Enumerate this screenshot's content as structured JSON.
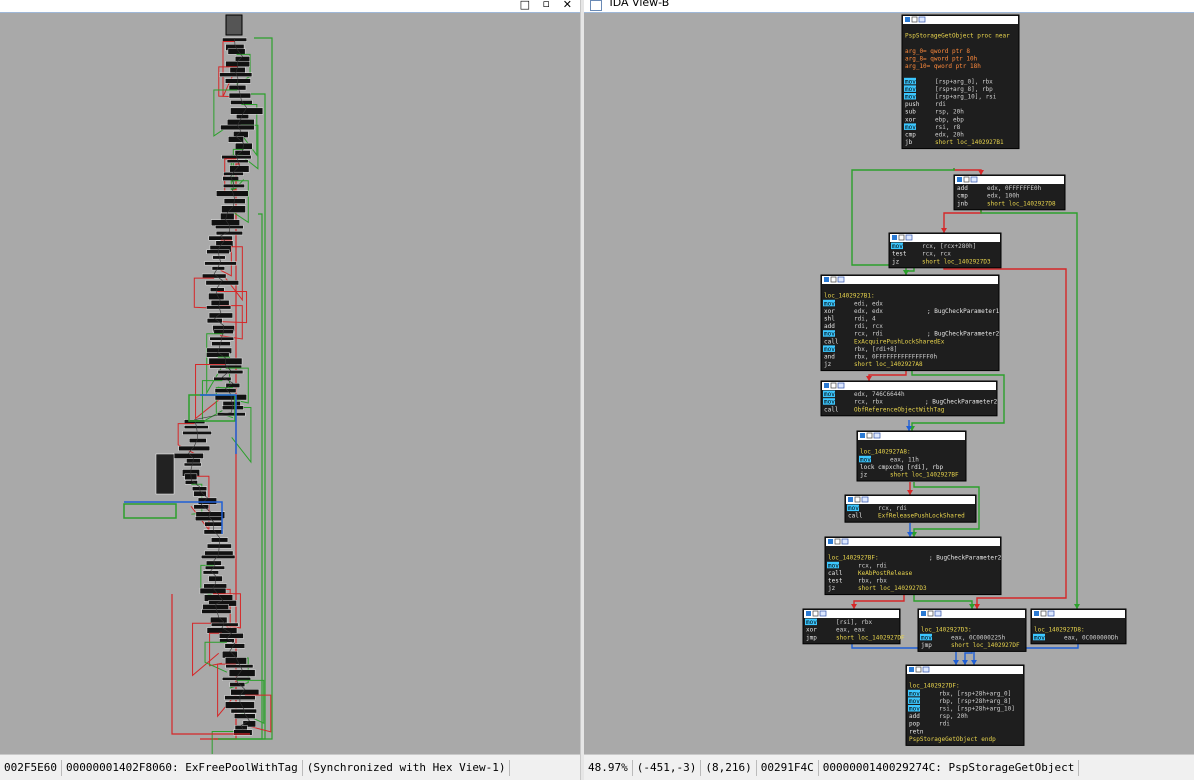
{
  "left_pane": {
    "status": {
      "address": "002F5E60",
      "location": "00000001402F8060: ExFreePoolWithTag",
      "sync": "(Synchronized with Hex View-1)"
    }
  },
  "right_pane": {
    "tab_title": "IDA View-B",
    "status": {
      "zoom": "48.97%",
      "coords": "(-451,-3)",
      "mouse": "(8,216)",
      "offset": "00291F4C",
      "location": "0000000140029274C: PspStorageGetObject"
    }
  },
  "colors": {
    "graph_bg": "#a9a9a9",
    "block_bg": "#1e1e1e",
    "edge_true": "#2ca02c",
    "edge_false": "#d62728",
    "edge_uncond": "#1f5fd6",
    "mnemonic_highlight": "#3cc7ff",
    "label_yellow": "#e8d44d",
    "operand_orange": "#ff8a3c"
  },
  "blocks": [
    {
      "id": "b1",
      "lines": [
        {
          "t": ""
        },
        {
          "t": "PspStorageGetObject proc near",
          "c": "label"
        },
        {
          "t": ""
        },
        {
          "t": "arg_0= qword ptr  8",
          "c": "orange"
        },
        {
          "t": "arg_8= qword ptr  10h",
          "c": "orange"
        },
        {
          "t": "arg_10= qword ptr  18h",
          "c": "orange"
        },
        {
          "t": ""
        },
        {
          "m": "mov",
          "o": "[rsp+arg_0], rbx"
        },
        {
          "m": "mov",
          "o": "[rsp+arg_8], rbp"
        },
        {
          "m": "mov",
          "o": "[rsp+arg_10], rsi"
        },
        {
          "m": "push",
          "o": "rdi"
        },
        {
          "m": "sub",
          "o": "rsp, 20h"
        },
        {
          "m": "xor",
          "o": "ebp, ebp"
        },
        {
          "m": "mov",
          "o": "rsi, r8"
        },
        {
          "m": "cmp",
          "o": "edx, 20h"
        },
        {
          "m": "jb",
          "o": "short loc_1402927B1"
        }
      ]
    },
    {
      "id": "b2",
      "lines": [
        {
          "m": "add",
          "o": "edx, 0FFFFFFE0h"
        },
        {
          "m": "cmp",
          "o": "edx, 100h"
        },
        {
          "m": "jnb",
          "o": "short loc_1402927D8"
        }
      ]
    },
    {
      "id": "b3",
      "lines": [
        {
          "m": "mov",
          "o": "rcx, [rcx+280h]"
        },
        {
          "m": "test",
          "o": "rcx, rcx"
        },
        {
          "m": "jz",
          "o": "short loc_1402927D3"
        }
      ]
    },
    {
      "id": "b4",
      "lines": [
        {
          "t": ""
        },
        {
          "t": "loc_1402927B1:",
          "c": "label"
        },
        {
          "m": "mov",
          "o": "edi, edx"
        },
        {
          "m": "xor",
          "o": "edx, edx",
          "cm": "; BugCheckParameter1"
        },
        {
          "m": "shl",
          "o": "rdi, 4"
        },
        {
          "m": "add",
          "o": "rdi, rcx"
        },
        {
          "m": "mov",
          "o": "rcx, rdi",
          "cm": "; BugCheckParameter2"
        },
        {
          "m": "call",
          "o": "ExAcquirePushLockSharedEx"
        },
        {
          "m": "mov",
          "o": "rbx, [rdi+8]"
        },
        {
          "m": "and",
          "o": "rbx, 0FFFFFFFFFFFFFFF0h"
        },
        {
          "m": "jz",
          "o": "short loc_1402927A8"
        }
      ]
    },
    {
      "id": "b5",
      "lines": [
        {
          "m": "mov",
          "o": "edx, 746C6644h"
        },
        {
          "m": "mov",
          "o": "rcx, rbx",
          "cm": "; BugCheckParameter2"
        },
        {
          "m": "call",
          "o": "ObfReferenceObjectWithTag"
        }
      ]
    },
    {
      "id": "b6",
      "lines": [
        {
          "t": ""
        },
        {
          "t": "loc_1402927A8:",
          "c": "label"
        },
        {
          "m": "mov",
          "o": "eax, 11h"
        },
        {
          "t": "lock cmpxchg [rdi], rbp",
          "c": "white"
        },
        {
          "m": "jz",
          "o": "short loc_1402927BF"
        }
      ]
    },
    {
      "id": "b7",
      "lines": [
        {
          "m": "mov",
          "o": "rcx, rdi"
        },
        {
          "m": "call",
          "o": "ExfReleasePushLockShared"
        }
      ]
    },
    {
      "id": "b8",
      "lines": [
        {
          "t": ""
        },
        {
          "t": "loc_1402927BF:",
          "c": "label",
          "cm": "; BugCheckParameter2"
        },
        {
          "m": "mov",
          "o": "rcx, rdi"
        },
        {
          "m": "call",
          "o": "KeAbPostRelease"
        },
        {
          "m": "test",
          "o": "rbx, rbx"
        },
        {
          "m": "jz",
          "o": "short loc_1402927D3"
        }
      ]
    },
    {
      "id": "b9",
      "lines": [
        {
          "m": "mov",
          "o": "[rsi], rbx"
        },
        {
          "m": "xor",
          "o": "eax, eax"
        },
        {
          "m": "jmp",
          "o": "short loc_1402927DF"
        }
      ]
    },
    {
      "id": "b10",
      "lines": [
        {
          "t": ""
        },
        {
          "t": "loc_1402927D3:",
          "c": "label"
        },
        {
          "m": "mov",
          "o": "eax, 0C0000225h"
        },
        {
          "m": "jmp",
          "o": "short loc_1402927DF"
        }
      ]
    },
    {
      "id": "b11",
      "lines": [
        {
          "t": ""
        },
        {
          "t": "loc_1402927D8:",
          "c": "label"
        },
        {
          "m": "mov",
          "o": "eax, 0C000000Dh"
        }
      ]
    },
    {
      "id": "b12",
      "lines": [
        {
          "t": ""
        },
        {
          "t": "loc_1402927DF:",
          "c": "label"
        },
        {
          "m": "mov",
          "o": "rbx, [rsp+28h+arg_0]"
        },
        {
          "m": "mov",
          "o": "rbp, [rsp+28h+arg_8]"
        },
        {
          "m": "mov",
          "o": "rsi, [rsp+28h+arg_10]"
        },
        {
          "m": "add",
          "o": "rsp, 20h"
        },
        {
          "m": "pop",
          "o": "rdi"
        },
        {
          "m": "retn",
          "o": ""
        },
        {
          "t": "PspStorageGetObject endp",
          "c": "label"
        }
      ]
    }
  ]
}
